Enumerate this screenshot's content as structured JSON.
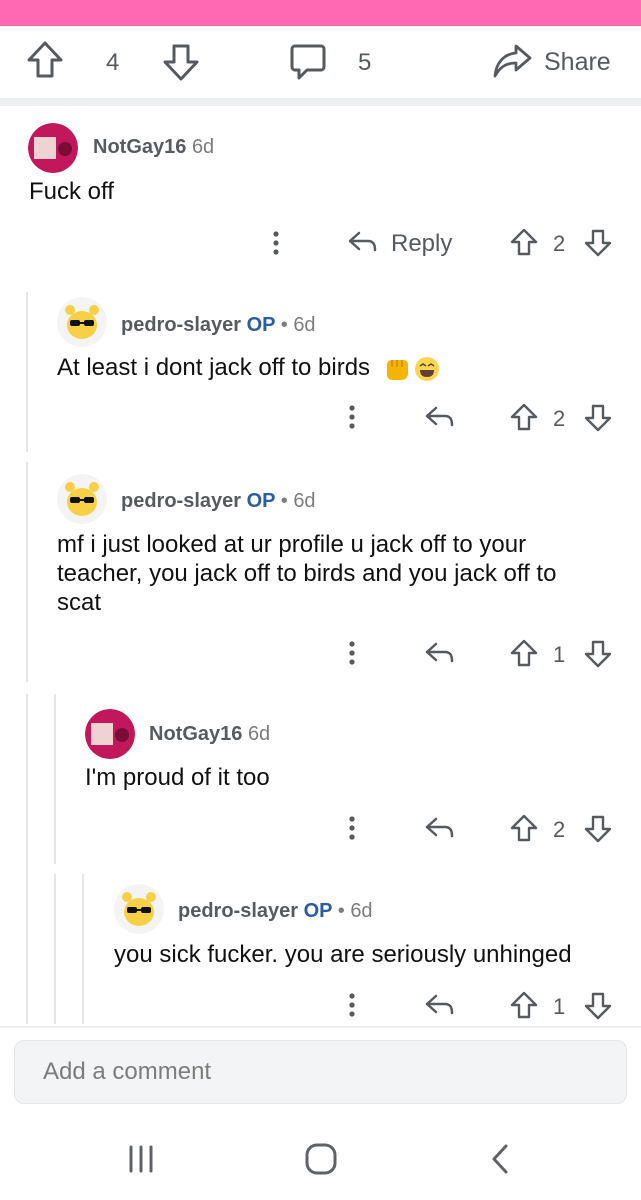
{
  "colors": {
    "topbar": "#ff69b4",
    "op_label": "#2a5ca8",
    "text_muted": "#555a5f"
  },
  "post_actions": {
    "upvotes": "4",
    "comments": "5",
    "share_label": "Share"
  },
  "comments": [
    {
      "username": "NotGay16",
      "op": "",
      "separator": "",
      "age": "6d",
      "body": "Fuck off",
      "reply_label": "Reply",
      "votes": "2"
    },
    {
      "username": "pedro-slayer",
      "op": "OP",
      "separator": "•",
      "age": "6d",
      "body": "At least i dont jack off to birds",
      "reply_label": "",
      "votes": "2",
      "emoji": [
        "fist-icon",
        "laughing-emoji-icon"
      ]
    },
    {
      "username": "pedro-slayer",
      "op": "OP",
      "separator": "•",
      "age": "6d",
      "body_lines": [
        "mf i just looked at ur profile u jack off to your",
        "teacher, you jack off to birds and you jack off to",
        "scat"
      ],
      "reply_label": "",
      "votes": "1"
    },
    {
      "username": "NotGay16",
      "op": "",
      "separator": "",
      "age": "6d",
      "body": "I'm proud of it too",
      "reply_label": "",
      "votes": "2"
    },
    {
      "username": "pedro-slayer",
      "op": "OP",
      "separator": "•",
      "age": "6d",
      "body": "you sick fucker. you are seriously unhinged",
      "reply_label": "",
      "votes": "1"
    }
  ],
  "composer": {
    "placeholder": "Add a comment"
  },
  "navbar": {
    "buttons": [
      "recent-apps-icon",
      "home-icon",
      "back-icon"
    ]
  }
}
